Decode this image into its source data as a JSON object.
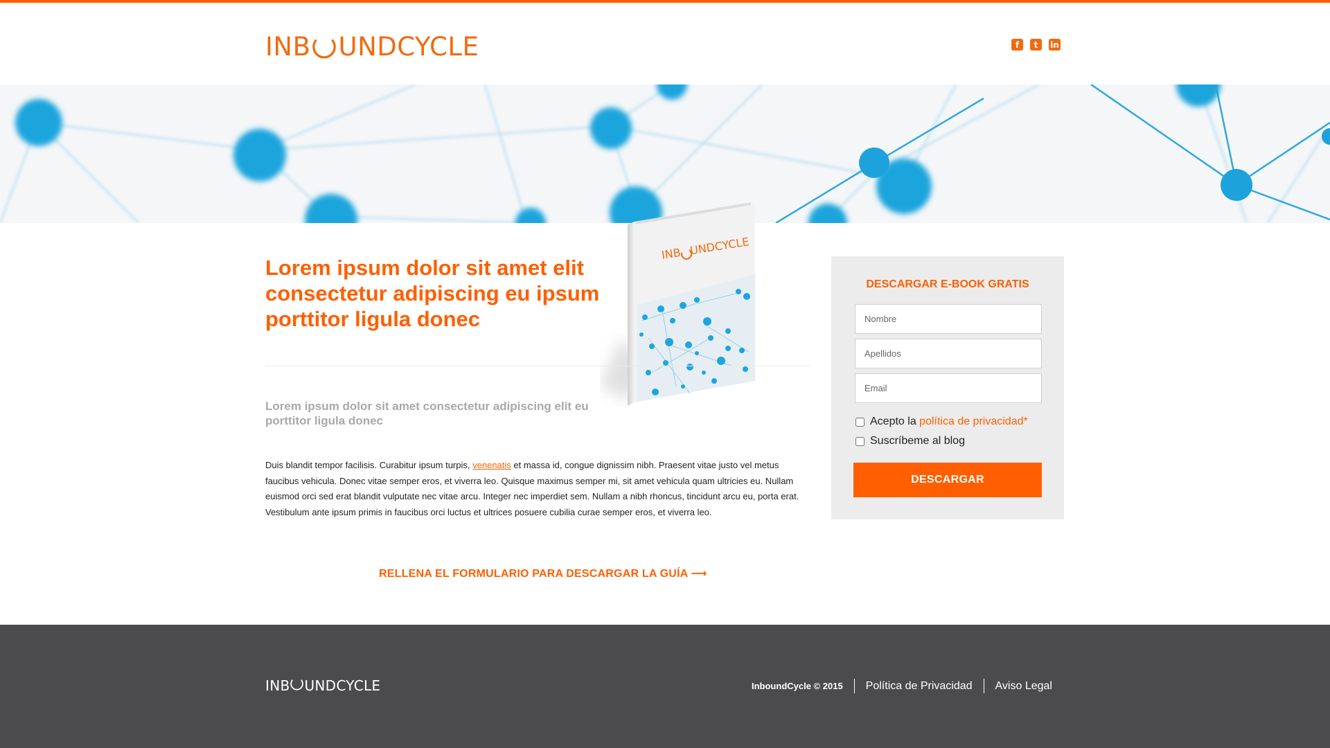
{
  "brand": {
    "logo_left": "INB",
    "logo_right": "UNDCYCLE",
    "accent": "#ff5f00"
  },
  "header": {
    "social": [
      {
        "icon": "facebook-icon",
        "glyph": "f"
      },
      {
        "icon": "twitter-icon",
        "glyph": "t"
      },
      {
        "icon": "linkedin-icon",
        "glyph": "in"
      }
    ]
  },
  "content": {
    "title": "Lorem ipsum dolor sit amet elit consectetur adipiscing eu ipsum porttitor ligula donec",
    "subtitle": "Lorem ipsum dolor sit amet consectetur adipiscing elit eu porttitor ligula donec",
    "body_before_link": "Duis blandit tempor facilisis. Curabitur ipsum turpis, ",
    "body_link": "venenatis",
    "body_after_link": " et massa id, congue dignissim nibh. Praesent vitae justo vel metus faucibus vehicula. Donec vitae semper eros, et viverra leo. Quisque maximus semper mi, sit amet vehicula quam ultricies eu. Nullam euismod orci sed erat blandit vulputate nec vitae arcu. Integer nec imperdiet sem. Nullam a nibh rhoncus, tincidunt arcu eu, porta erat. Vestibulum ante ipsum primis in faucibus orci luctus et ultrices posuere cubilia curae semper eros, et viverra leo.",
    "cta": "RELLENA EL FORMULARIO PARA DESCARGAR LA GUÍA ⟶"
  },
  "book": {
    "logo_left": "INB",
    "logo_right": "UNDCYCLE"
  },
  "form": {
    "title": "DESCARGAR E-BOOK GRATIS",
    "fields": {
      "nombre_placeholder": "Nombre",
      "apellidos_placeholder": "Apellidos",
      "email_placeholder": "Email"
    },
    "privacy_prefix": "Acepto la ",
    "privacy_link": "política de privacidad",
    "privacy_suffix": "*",
    "subscribe_label": "Suscríbeme al blog",
    "submit_label": "DESCARGAR"
  },
  "footer": {
    "logo_left": "INB",
    "logo_right": "UNDCYCLE",
    "copyright": "InboundCycle © 2015",
    "links": [
      "Política de Privacidad",
      "Aviso Legal"
    ],
    "background": "#4b4b4d"
  }
}
